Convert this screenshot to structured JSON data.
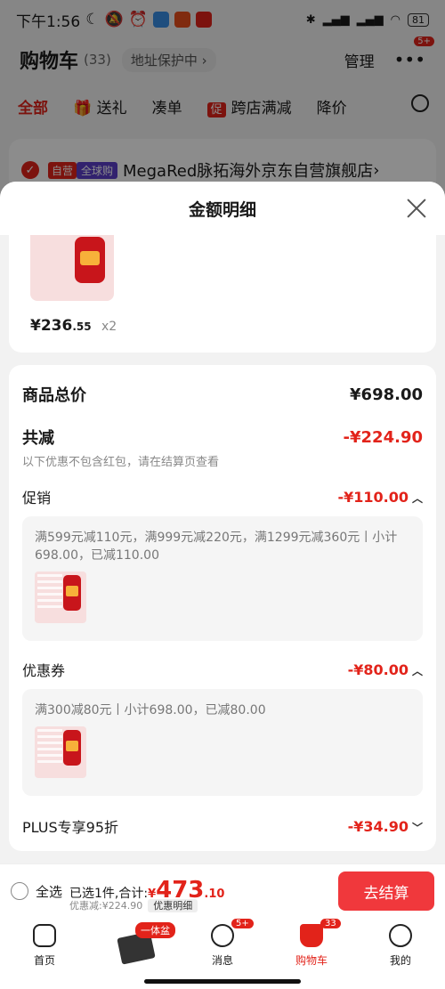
{
  "status": {
    "time": "下午1:56",
    "battery": "81"
  },
  "bg": {
    "title": "购物车",
    "count": "(33)",
    "address": "地址保护中",
    "manage": "管理",
    "more_badge": "5+",
    "tabs": [
      "全部",
      "送礼",
      "凑单",
      "跨店满减",
      "降价"
    ],
    "store_tag1": "自营",
    "store_tag2": "全球购",
    "store_name": "MegaRed脉拓海外京东自营旗舰店"
  },
  "sheet": {
    "title": "金额明细",
    "product": {
      "price_main": "¥236",
      "price_dec": ".55",
      "qty": "x2"
    },
    "total_label": "商品总价",
    "total_value": "¥698.00",
    "reduce_label": "共减",
    "reduce_value": "-¥224.90",
    "reduce_note": "以下优惠不包含红包，请在结算页查看",
    "promo_label": "促销",
    "promo_value": "-¥110.00",
    "promo_text": "满599元减110元，满999元减220元，满1299元减360元丨小计698.00，已减110.00",
    "coupon_label": "优惠券",
    "coupon_value": "-¥80.00",
    "coupon_text": "满300减80元丨小计698.00，已减80.00",
    "plus_label": "PLUS专享95折",
    "plus_value": "-¥34.90"
  },
  "checkout": {
    "select_all": "全选",
    "selected": "已选1件,合计:",
    "currency": "¥",
    "amount_int": "473",
    "amount_dec": ".10",
    "discount": "优惠减:¥224.90",
    "detail_btn": "优惠明细",
    "go": "去结算"
  },
  "nav": {
    "home": "首页",
    "center_pill": "一体盆",
    "msg": "消息",
    "msg_badge": "5+",
    "cart": "购物车",
    "cart_badge": "33",
    "me": "我的"
  }
}
